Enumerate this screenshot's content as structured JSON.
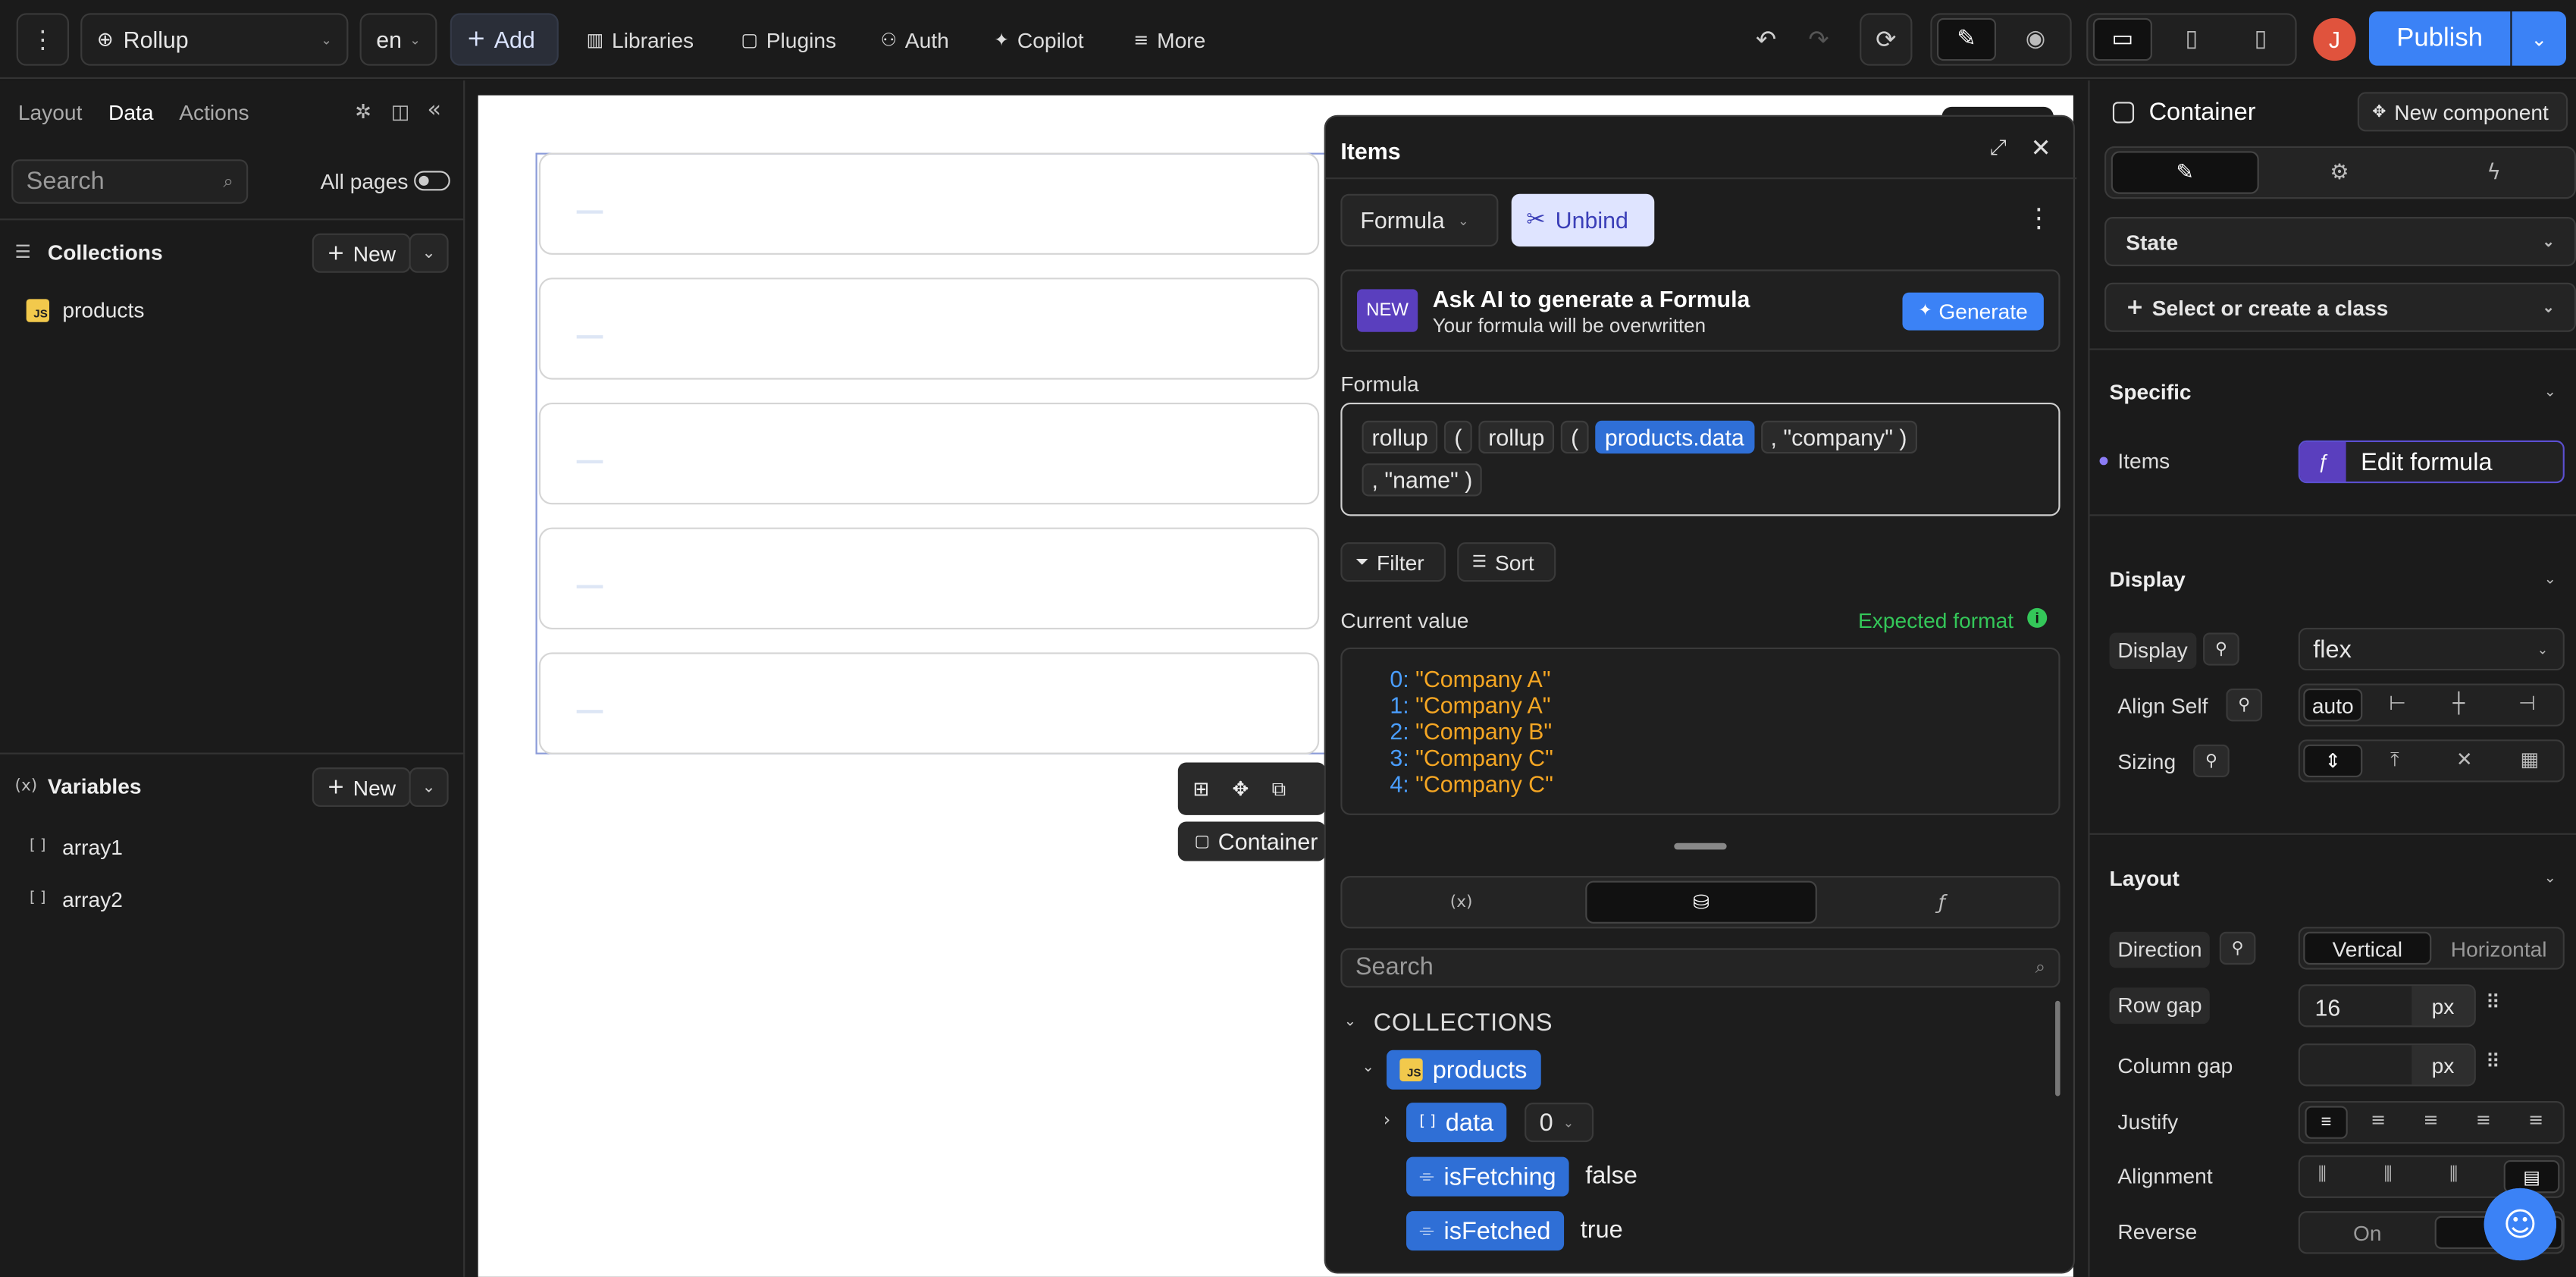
{
  "topbar": {
    "project": "Rollup",
    "language": "en",
    "add": "Add",
    "menu": [
      "Libraries",
      "Plugins",
      "Auth",
      "Copilot",
      "More"
    ],
    "avatar_initial": "J",
    "publish": "Publish"
  },
  "left": {
    "tabs": [
      "Layout",
      "Data",
      "Actions"
    ],
    "search_placeholder": "Search",
    "all_pages": "All pages",
    "collections_title": "Collections",
    "new_label": "New",
    "collections": [
      "products"
    ],
    "variables_title": "Variables",
    "variables": [
      "array1",
      "array2"
    ]
  },
  "canvas": {
    "container_tag": "Container"
  },
  "items_panel": {
    "title": "Items",
    "mode": "Formula",
    "unbind": "Unbind",
    "ai_badge": "NEW",
    "ai_title": "Ask AI to generate a Formula",
    "ai_subtitle": "Your formula will be overwritten",
    "generate": "Generate",
    "formula_label": "Formula",
    "formula_tokens_line1": [
      "rollup",
      "(",
      "rollup",
      "(",
      "products.data",
      ", \"company\" )"
    ],
    "formula_tokens_line2": [
      ", \"name\" )"
    ],
    "filter": "Filter",
    "sort": "Sort",
    "current_value_label": "Current value",
    "expected_format": "Expected format",
    "current_values": [
      {
        "index": "0",
        "value": "\"Company A\""
      },
      {
        "index": "1",
        "value": "\"Company A\""
      },
      {
        "index": "2",
        "value": "\"Company B\""
      },
      {
        "index": "3",
        "value": "\"Company C\""
      },
      {
        "index": "4",
        "value": "\"Company C\""
      }
    ],
    "search_placeholder": "Search",
    "tree": {
      "section": "COLLECTIONS",
      "collection": "products",
      "data_label": "data",
      "data_index": "0",
      "is_fetching_label": "isFetching",
      "is_fetching_value": "false",
      "is_fetched_label": "isFetched",
      "is_fetched_value": "true"
    }
  },
  "right": {
    "element_title": "Container",
    "new_component": "New component",
    "state": "State",
    "class_select": "Select or create a class",
    "specific": "Specific",
    "items_label": "Items",
    "edit_formula": "Edit formula",
    "display_section": "Display",
    "display_label": "Display",
    "display_value": "flex",
    "align_self_label": "Align Self",
    "align_self_value": "auto",
    "sizing_label": "Sizing",
    "layout_section": "Layout",
    "direction_label": "Direction",
    "direction_options": [
      "Vertical",
      "Horizontal"
    ],
    "row_gap_label": "Row gap",
    "row_gap_value": "16",
    "unit": "px",
    "column_gap_label": "Column gap",
    "justify_label": "Justify",
    "alignment_label": "Alignment",
    "reverse_label": "Reverse",
    "reverse_on": "On"
  },
  "colors": {
    "accent": "#3b82f6",
    "canvas_bg": "#ffffff",
    "panel_bg": "#1b1b1b",
    "string_value": "#f5a623",
    "index_value": "#4a9eff"
  }
}
